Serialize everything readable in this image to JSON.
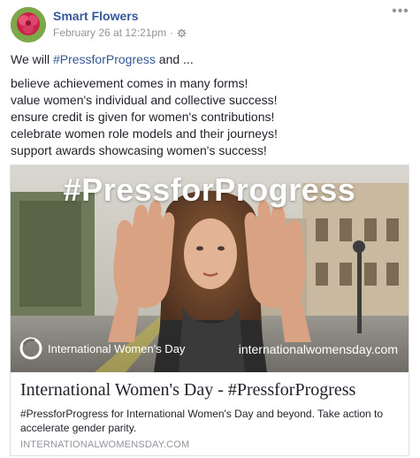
{
  "post": {
    "author": "Smart Flowers",
    "timestamp": "February 26 at 12:21pm",
    "privacy_icon": "gear-icon",
    "more_label": "•••",
    "message": {
      "intro_prefix": "We will ",
      "intro_hashtag": "#PressforProgress",
      "intro_suffix": " and ...",
      "lines": [
        "believe achievement comes in many forms!",
        "value women's individual and collective success!",
        "ensure credit is given for women's contributions!",
        "celebrate women role models and their journeys!",
        "support awards showcasing women's success!"
      ]
    },
    "link_card": {
      "image_headline": "#PressforProgress",
      "image_logo_text": "International Women's Day",
      "image_url_text": "internationalwomensday.com",
      "title": "International Women's Day - #PressforProgress",
      "description": "#PressforProgress for International Women's Day and beyond. Take action to accelerate gender parity.",
      "domain": "INTERNATIONALWOMENSDAY.COM"
    }
  },
  "colors": {
    "link_blue": "#365899",
    "meta_gray": "#90949c",
    "text_dark": "#1d2129",
    "border": "#dddfe2"
  }
}
